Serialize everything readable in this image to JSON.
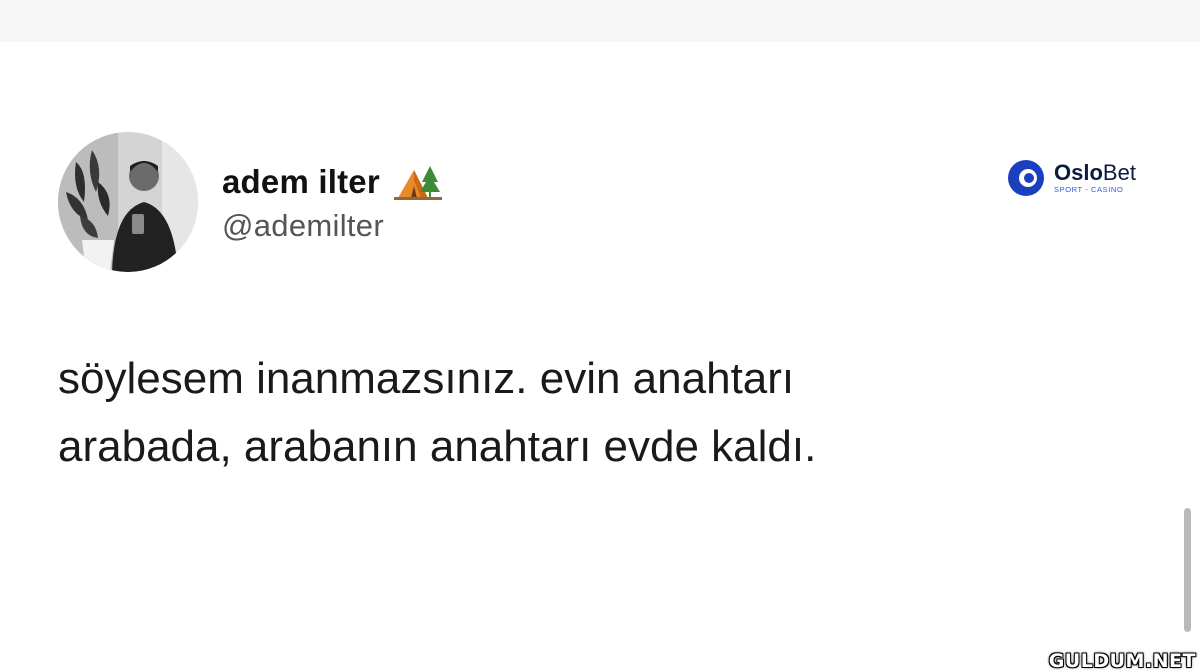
{
  "tweet": {
    "author_name": "adem ilter",
    "name_emoji_icon": "camping-tent-icon",
    "handle": "@ademilter",
    "text_lines": [
      "söylesem inanmazsınız. evin anahtarı",
      "arabada, arabanın anahtarı evde kaldı."
    ]
  },
  "brand_logo": {
    "name_part1": "Oslo",
    "name_part2": "Bet",
    "tagline": "SPORT - CASINO",
    "colors": {
      "primary": "#1a3fbf",
      "accent": "#2b5bd8",
      "text": "#0d1b3e"
    }
  },
  "watermark": {
    "text": "GULDUM.NET"
  },
  "colors": {
    "background": "#ffffff",
    "top_strip": "#f6f6f6",
    "name_text": "#111111",
    "handle_text": "#555555",
    "body_text": "#1a1a1a"
  }
}
